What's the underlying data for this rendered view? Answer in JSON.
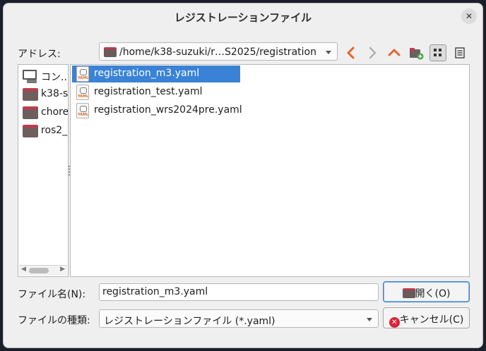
{
  "window": {
    "title": "レジストレーションファイル"
  },
  "address": {
    "label": "アドレス:",
    "path": "/home/k38-suzuki/r…S2025/registration"
  },
  "toolbar": {
    "back_icon": "chevron-left-icon",
    "forward_icon": "chevron-right-icon",
    "up_icon": "chevron-up-icon",
    "new_folder_icon": "new-folder-icon",
    "icon_view_icon": "grid-view-icon",
    "list_view_icon": "list-view-icon",
    "accent": "#e8642c"
  },
  "sidebar": {
    "items": [
      {
        "label": "コン...",
        "icon": "computer-icon"
      },
      {
        "label": "k38-s",
        "icon": "folder-icon"
      },
      {
        "label": "chore",
        "icon": "folder-icon"
      },
      {
        "label": "ros2_",
        "icon": "folder-icon"
      }
    ]
  },
  "files": [
    {
      "name": "registration_m3.yaml",
      "selected": true
    },
    {
      "name": "registration_test.yaml",
      "selected": false
    },
    {
      "name": "registration_wrs2024pre.yaml",
      "selected": false
    }
  ],
  "filename": {
    "label": "ファイル名(N):",
    "value": "registration_m3.yaml"
  },
  "filetype": {
    "label": "ファイルの種類:",
    "value": "レジストレーションファイル (*.yaml)"
  },
  "buttons": {
    "open": "開く(O)",
    "cancel": "キャンセル(C)"
  },
  "colors": {
    "selection": "#3a82d6",
    "folder_accent": "#c23a4a",
    "cancel_red": "#d9253a"
  }
}
